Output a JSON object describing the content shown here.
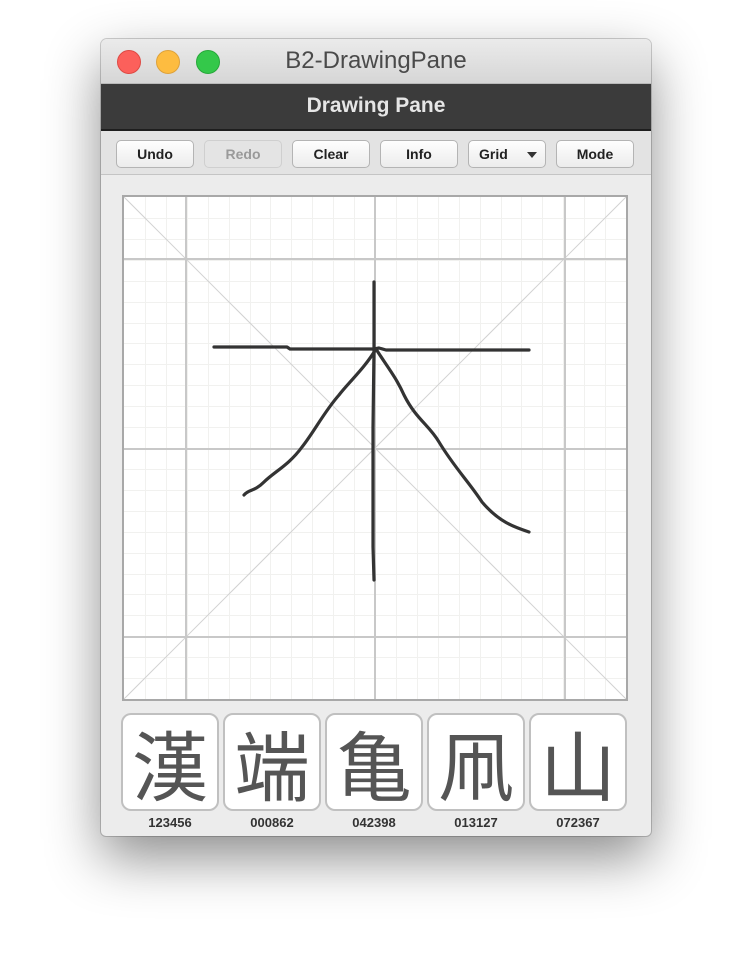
{
  "window": {
    "title": "B2-DrawingPane",
    "controls": [
      "close",
      "minimize",
      "maximize"
    ]
  },
  "header": {
    "title": "Drawing Pane"
  },
  "toolbar": {
    "undo_label": "Undo",
    "redo_label": "Redo",
    "clear_label": "Clear",
    "info_label": "Info",
    "grid_label": "Grid",
    "mode_label": "Mode",
    "redo_enabled": false
  },
  "canvas": {
    "grid": "on",
    "stroke_color": "#333333",
    "strokes_count": 4
  },
  "candidates": [
    {
      "char": "漢",
      "code": "123456"
    },
    {
      "char": "端",
      "code": "000862"
    },
    {
      "char": "亀",
      "code": "042398"
    },
    {
      "char": "凧",
      "code": "013127"
    },
    {
      "char": "山",
      "code": "072367"
    }
  ]
}
